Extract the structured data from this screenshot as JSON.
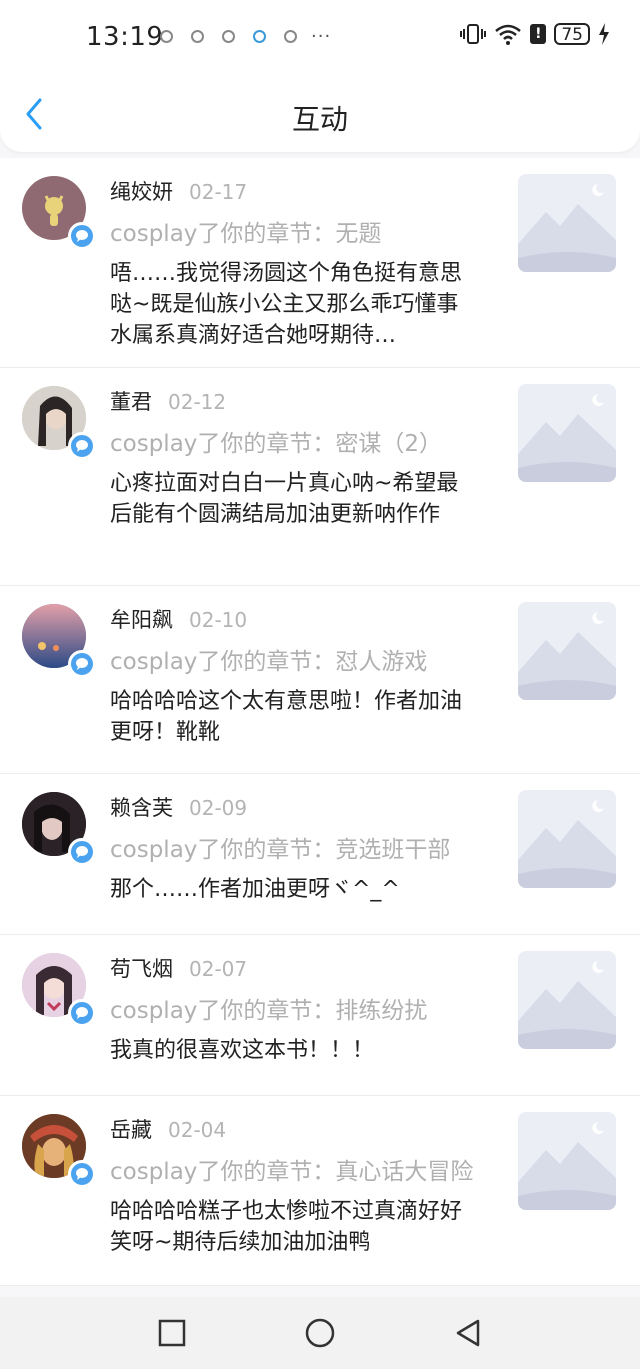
{
  "status_bar": {
    "time": "13:19",
    "more": "···",
    "battery": "75"
  },
  "header": {
    "title": "互动",
    "back_icon": "chevron-left-icon",
    "accent": "#2a9df4"
  },
  "items": [
    {
      "name": "绳姣妍",
      "date": "02-17",
      "action": "cosplay了你的章节：无题",
      "comment": "唔……我觉得汤圆这个角色挺有意思哒~既是仙族小公主又那么乖巧懂事水属系真滴好适合她呀期待…",
      "avatar_color": "#8f6a72"
    },
    {
      "name": "董君",
      "date": "02-12",
      "action": "cosplay了你的章节：密谋（2）",
      "comment": "心疼拉面对白白一片真心呐~希望最后能有个圆满结局加油更新呐作作",
      "avatar_color": "#c9c3bd"
    },
    {
      "name": "牟阳飙",
      "date": "02-10",
      "action": "cosplay了你的章节：怼人游戏",
      "comment": "哈哈哈哈这个太有意思啦！作者加油更呀！靴靴",
      "avatar_color": "#5a6ea0"
    },
    {
      "name": "赖含芙",
      "date": "02-09",
      "action": "cosplay了你的章节：竞选班干部",
      "comment": "那个……作者加油更呀ヾ^_^",
      "avatar_color": "#3b3036"
    },
    {
      "name": "苟飞烟",
      "date": "02-07",
      "action": "cosplay了你的章节：排练纷扰",
      "comment": "我真的很喜欢这本书！！！",
      "avatar_color": "#c7a9c4"
    },
    {
      "name": "岳藏",
      "date": "02-04",
      "action": "cosplay了你的章节：真心话大冒险",
      "comment": "哈哈哈哈糕子也太惨啦不过真滴好好笑呀~期待后续加油加油鸭",
      "avatar_color": "#b96a3c"
    }
  ],
  "nav": {
    "icons": [
      "square-icon",
      "circle-icon",
      "triangle-back-icon"
    ]
  }
}
